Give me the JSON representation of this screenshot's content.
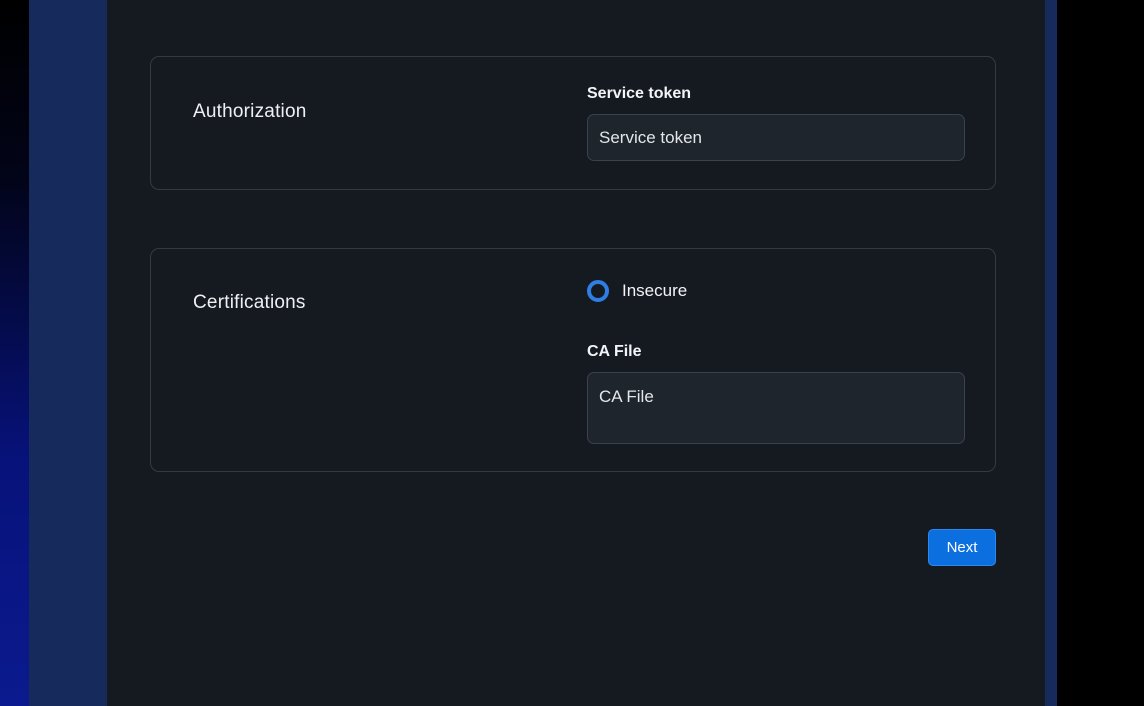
{
  "authorization": {
    "title": "Authorization",
    "service_token_label": "Service token",
    "service_token_placeholder": "Service token",
    "service_token_value": ""
  },
  "certifications": {
    "title": "Certifications",
    "insecure_label": "Insecure",
    "insecure_checked": false,
    "ca_file_label": "CA File",
    "ca_file_placeholder": "CA File",
    "ca_file_value": ""
  },
  "actions": {
    "next_label": "Next"
  },
  "colors": {
    "accent": "#0c6fe0",
    "radio_ring": "#2f7ee6",
    "panel_background": "#151a21",
    "frame_border": "#162b5c"
  }
}
